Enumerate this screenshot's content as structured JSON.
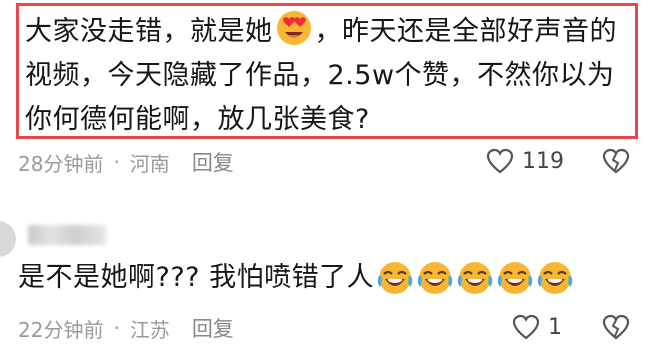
{
  "comment1": {
    "text_part1": "大家没走错，就是她",
    "emoji1": "heart-eyes-emoji",
    "text_part2": "，昨天还是全部好声音的视频，今天隐藏了作品，2.5w个赞，不然你以为你何德何能啊，放几张美食?",
    "time": "28分钟前",
    "separator": "·",
    "location": "河南",
    "reply_label": "回复",
    "like_count": "119"
  },
  "comment2": {
    "text": "是不是她啊??? 我怕喷错了人",
    "emoji_count": 5,
    "emoji": "rolling-laugh-emoji",
    "time": "22分钟前",
    "separator": "·",
    "location": "江苏",
    "reply_label": "回复",
    "like_count": "1"
  },
  "colors": {
    "highlight_border": "#e5484d",
    "meta_text": "#9a9a9a",
    "text": "#161616"
  }
}
